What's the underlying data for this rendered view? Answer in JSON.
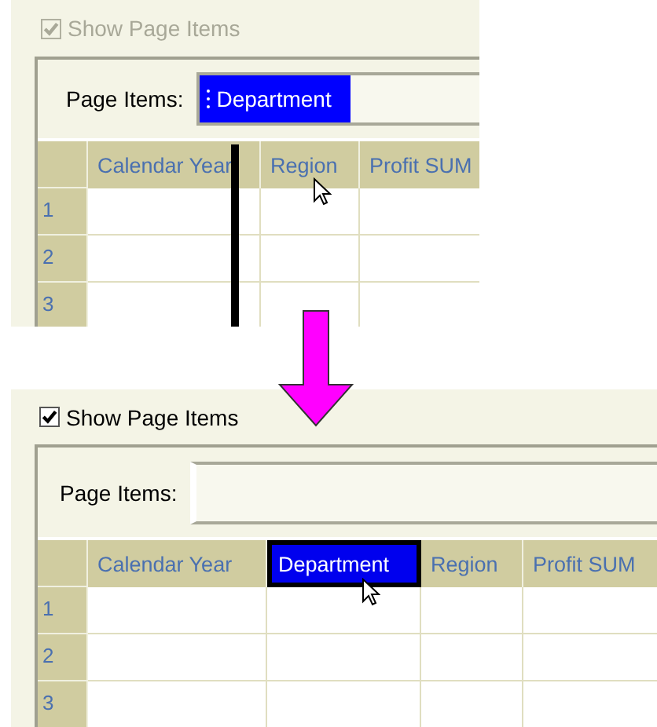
{
  "panels": [
    {
      "show_page_items": {
        "label": "Show Page Items",
        "checked": true,
        "disabled": true
      },
      "page_items_label": "Page Items:",
      "page_items": [
        {
          "label": "Department",
          "selected": true
        }
      ],
      "drop_marker": true,
      "columns": [
        {
          "label": "Calendar Year",
          "selected": false
        },
        {
          "label": "Region",
          "selected": false
        },
        {
          "label": "Profit SUM",
          "selected": false
        }
      ],
      "rows": [
        "1",
        "2",
        "3"
      ]
    },
    {
      "show_page_items": {
        "label": "Show Page Items",
        "checked": true,
        "disabled": false
      },
      "page_items_label": "Page Items:",
      "columns": [
        {
          "label": "Calendar Year",
          "selected": false
        },
        {
          "label": "Department",
          "selected": true
        },
        {
          "label": "Region",
          "selected": false
        },
        {
          "label": "Profit SUM",
          "selected": false
        }
      ],
      "rows": [
        "1",
        "2",
        "3"
      ]
    }
  ]
}
